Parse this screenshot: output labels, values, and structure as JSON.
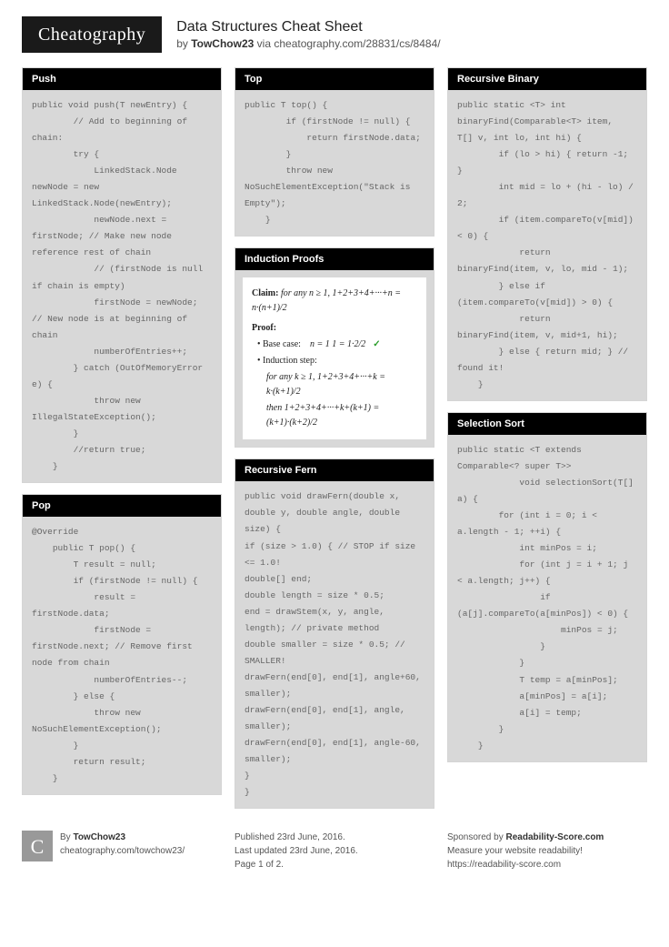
{
  "header": {
    "logo": "Cheatography",
    "title": "Data Structures Cheat Sheet",
    "by_prefix": "by ",
    "author": "TowChow23",
    "via": " via ",
    "url": "cheatography.com/28831/cs/8484/"
  },
  "cards": {
    "push": {
      "title": "Push",
      "code": "public void push(T newEntry) {\n        // Add to beginning of chain:\n        try {\n            LinkedStack.Node newNode = new LinkedStack.Node(newEntry);\n            newNode.next = firstNode; // Make new node reference rest of chain\n            // (firstNode is null if chain is empty)\n            firstNode = newNode; // New node is at beginning of chain\n            numberOfEntries++;\n        } catch (OutOfMemoryError e) {\n            throw new IllegalStateException();\n        }\n        //return true;\n    }"
    },
    "pop": {
      "title": "Pop",
      "code": "@Override\n    public T pop() {\n        T result = null;\n        if (firstNode != null) {\n            result = firstNode.data;\n            firstNode = firstNode.next; // Remove first node from chain\n            numberOfEntries--;\n        } else {\n            throw new NoSuchElementException();\n        }\n        return result;\n    }"
    },
    "top": {
      "title": "Top",
      "code": "public T top() {\n        if (firstNode != null) {\n            return firstNode.data;\n        }\n        throw new NoSuchElementException(\"Stack is Empty\");\n    }"
    },
    "induction": {
      "title": "Induction Proofs",
      "claim_prefix": "Claim:",
      "claim": "for any n ≥ 1,   1+2+3+4+···+n = n·(n+1)/2",
      "proof_label": "Proof:",
      "base_label": "Base case:",
      "base": "n = 1     1 = 1·2/2",
      "check": "✓",
      "step_label": "Induction step:",
      "step1": "for any k ≥ 1,   1+2+3+4+···+k = k·(k+1)/2",
      "step2": "then   1+2+3+4+···+k+(k+1) = (k+1)·(k+2)/2"
    },
    "fern": {
      "title": "Recursive Fern",
      "code": "public void drawFern(double x, double y, double angle, double size) {\nif (size > 1.0) { // STOP if size <= 1.0!\ndouble[] end;\ndouble length = size * 0.5;\nend = drawStem(x, y, angle, length); // private method\ndouble smaller = size * 0.5; // SMALLER!\ndrawFern(end[0], end[1], angle+60, smaller);\ndrawFern(end[0], end[1], angle, smaller);\ndrawFern(end[0], end[1], angle-60, smaller);\n}\n}"
    },
    "binary": {
      "title": "Recursive Binary",
      "code": "public static <T> int binaryFind(Comparable<T> item,  T[] v, int lo, int hi) {\n        if (lo > hi) { return -1; }\n        int mid = lo + (hi - lo) / 2;\n        if (item.compareTo(v[mid]) < 0) {\n            return binaryFind(item, v, lo, mid - 1);\n        } else if (item.compareTo(v[mid]) > 0) {\n            return binaryFind(item, v, mid+1, hi);\n        } else { return mid; } // found it!\n    }"
    },
    "selection": {
      "title": "Selection Sort",
      "code": "public static <T extends Comparable<? super T>>\n            void selectionSort(T[] a) {\n        for (int i = 0; i < a.length - 1; ++i) {\n            int minPos = i;\n            for (int j = i + 1; j < a.length; j++) {\n                if (a[j].compareTo(a[minPos]) < 0) {\n                    minPos = j;\n                }\n            }\n            T temp = a[minPos];\n            a[minPos] = a[i];\n            a[i] = temp;\n        }\n    }"
    }
  },
  "footer": {
    "col1": {
      "icon": "C",
      "by_prefix": "By ",
      "author": "TowChow23",
      "url": "cheatography.com/towchow23/"
    },
    "col2": {
      "published": "Published 23rd June, 2016.",
      "updated": "Last updated 23rd June, 2016.",
      "page": "Page 1 of 2."
    },
    "col3": {
      "sponsored_prefix": "Sponsored by ",
      "sponsor": "Readability-Score.com",
      "tagline": "Measure your website readability!",
      "url": "https://readability-score.com"
    }
  }
}
